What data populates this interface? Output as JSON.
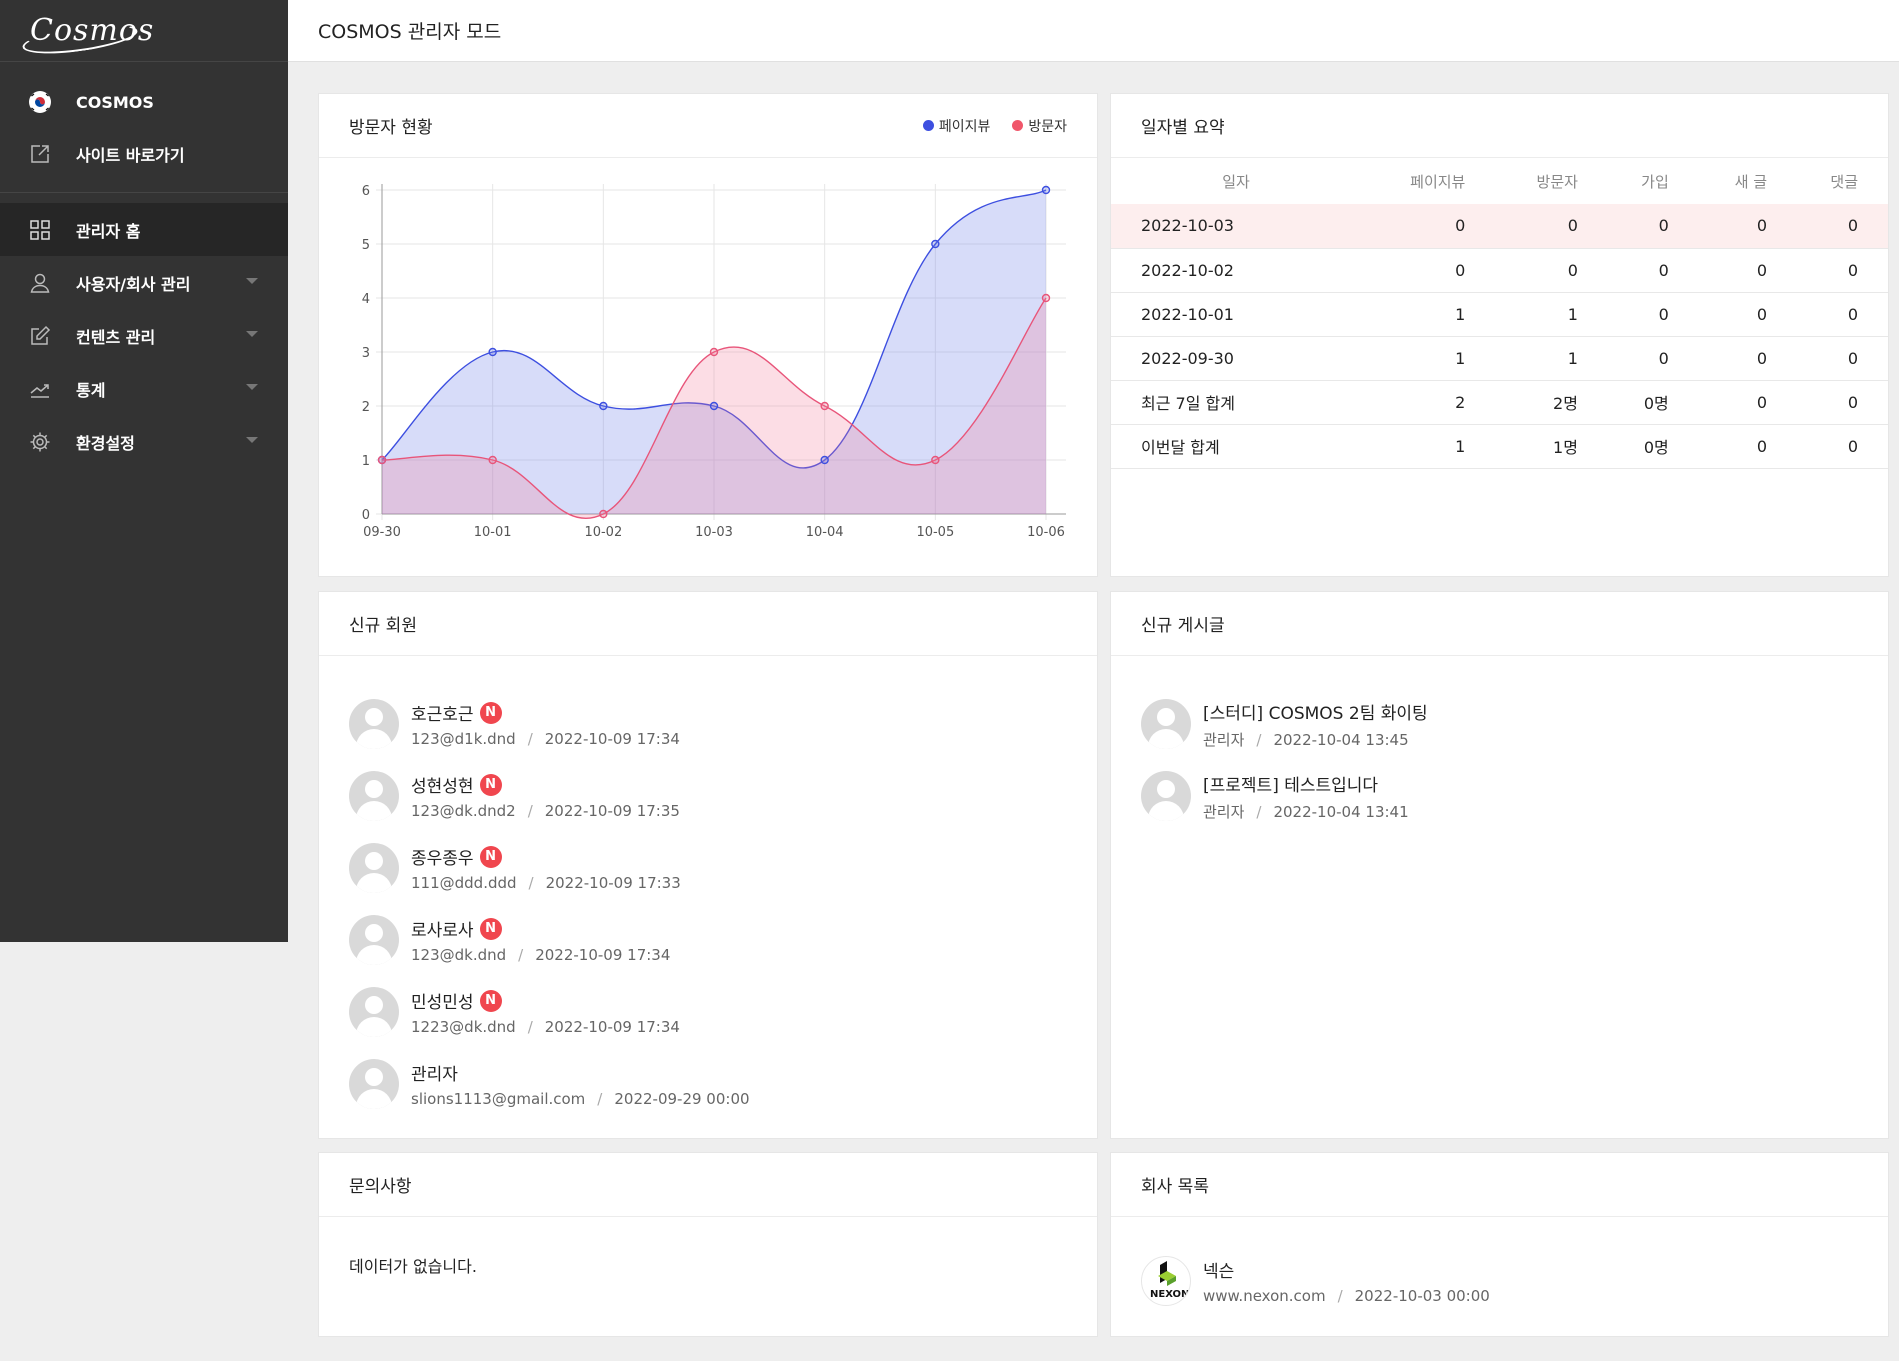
{
  "sidebar": {
    "logo": "Cosmos",
    "top_items": [
      {
        "label": "COSMOS"
      },
      {
        "label": "사이트 바로가기"
      }
    ],
    "menu": [
      {
        "label": "관리자 홈",
        "active": true
      },
      {
        "label": "사용자/회사 관리",
        "has_submenu": true
      },
      {
        "label": "컨텐츠 관리",
        "has_submenu": true
      },
      {
        "label": "통계",
        "has_submenu": true
      },
      {
        "label": "환경설정",
        "has_submenu": true
      }
    ]
  },
  "header": {
    "title": "COSMOS 관리자 모드"
  },
  "visitors": {
    "title": "방문자 현황",
    "legend": [
      {
        "name": "페이지뷰",
        "color": "#3d4fe0"
      },
      {
        "name": "방문자",
        "color": "#f0566a"
      }
    ]
  },
  "chart_data": {
    "type": "area",
    "x": [
      "09-30",
      "10-01",
      "10-02",
      "10-03",
      "10-04",
      "10-05",
      "10-06"
    ],
    "series": [
      {
        "name": "페이지뷰",
        "values": [
          1,
          3,
          2,
          2,
          1,
          5,
          6
        ],
        "color": "#3d4fe0",
        "fill": "rgba(110,130,235,0.28)"
      },
      {
        "name": "방문자",
        "values": [
          1,
          1,
          0,
          3,
          2,
          1,
          4
        ],
        "color": "#e8557a",
        "fill": "rgba(245,120,150,0.25)"
      }
    ],
    "yticks": [
      "0",
      "1",
      "2",
      "3",
      "4",
      "5",
      "6"
    ],
    "ylim": [
      0,
      6
    ],
    "grid": true,
    "legend_position": "top-right"
  },
  "summary": {
    "title": "일자별 요약",
    "columns": [
      "일자",
      "페이지뷰",
      "방문자",
      "가입",
      "새 글",
      "댓글"
    ],
    "rows": [
      [
        "2022-10-03",
        "0",
        "0",
        "0",
        "0",
        "0"
      ],
      [
        "2022-10-02",
        "0",
        "0",
        "0",
        "0",
        "0"
      ],
      [
        "2022-10-01",
        "1",
        "1",
        "0",
        "0",
        "0"
      ],
      [
        "2022-09-30",
        "1",
        "1",
        "0",
        "0",
        "0"
      ],
      [
        "최근 7일 합계",
        "2",
        "2명",
        "0명",
        "0",
        "0"
      ],
      [
        "이번달 합계",
        "1",
        "1명",
        "0명",
        "0",
        "0"
      ]
    ]
  },
  "new_members": {
    "title": "신규 회원",
    "badge": "N",
    "items": [
      {
        "name": "호근호근",
        "email": "123@d1k.dnd",
        "date": "2022-10-09 17:34",
        "is_new": true
      },
      {
        "name": "성현성현",
        "email": "123@dk.dnd2",
        "date": "2022-10-09 17:35",
        "is_new": true
      },
      {
        "name": "종우종우",
        "email": "111@ddd.ddd",
        "date": "2022-10-09 17:33",
        "is_new": true
      },
      {
        "name": "로사로사",
        "email": "123@dk.dnd",
        "date": "2022-10-09 17:34",
        "is_new": true
      },
      {
        "name": "민성민성",
        "email": "1223@dk.dnd",
        "date": "2022-10-09 17:34",
        "is_new": true
      },
      {
        "name": "관리자",
        "email": "slions1113@gmail.com",
        "date": "2022-09-29 00:00",
        "is_new": false
      }
    ]
  },
  "new_posts": {
    "title": "신규 게시글",
    "items": [
      {
        "title": "[스터디] COSMOS 2팀 화이팅",
        "author": "관리자",
        "date": "2022-10-04 13:45"
      },
      {
        "title": "[프로젝트] 테스트입니다",
        "author": "관리자",
        "date": "2022-10-04 13:41"
      }
    ]
  },
  "inquiries": {
    "title": "문의사항",
    "empty_text": "데이터가 없습니다."
  },
  "companies": {
    "title": "회사 목록",
    "items": [
      {
        "name": "넥슨",
        "url": "www.nexon.com",
        "date": "2022-10-03 00:00",
        "logo_text": "NEXON"
      }
    ]
  },
  "separator": "/"
}
